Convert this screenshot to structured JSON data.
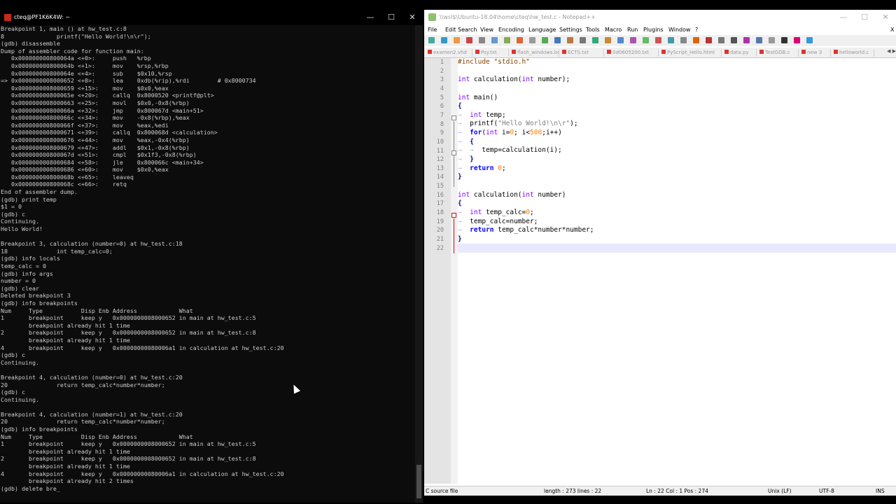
{
  "terminal": {
    "title": "cteq@PF1K6K4W: ~",
    "lines": [
      "Breakpoint 1, main () at hw_test.c:8",
      "8               printf(\"Hello World!\\n\\r\");",
      "(gdb) disassemble",
      "Dump of assembler code for function main:",
      "   0x000000000800064a <+0>:     push   %rbp",
      "   0x000000000800064b <+1>:     mov    %rsp,%rbp",
      "   0x000000000800064e <+4>:     sub    $0x10,%rsp",
      "=> 0x0000000008000652 <+8>:     lea    0xdb(%rip),%rdi        # 0x8000734",
      "   0x0000000008000659 <+15>:    mov    $0x0,%eax",
      "   0x000000000800065e <+20>:    callq  0x8000520 <printf@plt>",
      "   0x0000000008000663 <+25>:    movl   $0x0,-0x8(%rbp)",
      "   0x000000000800066a <+32>:    jmp    0x800067d <main+51>",
      "   0x000000000800066c <+34>:    mov    -0x8(%rbp),%eax",
      "   0x000000000800066f <+37>:    mov    %eax,%edi",
      "   0x0000000008000671 <+39>:    callq  0x800068d <calculation>",
      "   0x0000000008000676 <+44>:    mov    %eax,-0x4(%rbp)",
      "   0x0000000008000679 <+47>:    addl   $0x1,-0x8(%rbp)",
      "   0x000000000800067d <+51>:    cmpl   $0x1f3,-0x8(%rbp)",
      "   0x0000000008000684 <+58>:    jle    0x800066c <main+34>",
      "   0x0000000008000686 <+60>:    mov    $0x0,%eax",
      "   0x000000000800068b <+65>:    leaveq",
      "   0x000000000800068c <+66>:    retq",
      "End of assembler dump.",
      "(gdb) print temp",
      "$1 = 0",
      "(gdb) c",
      "Continuing.",
      "Hello World!",
      "",
      "Breakpoint 3, calculation (number=0) at hw_test.c:18",
      "18              int temp_calc=0;",
      "(gdb) info locals",
      "temp_calc = 0",
      "(gdb) info args",
      "number = 0",
      "(gdb) clear",
      "Deleted breakpoint 3",
      "(gdb) info breakpoints",
      "Num     Type           Disp Enb Address            What",
      "1       breakpoint     keep y   0x0000000008000652 in main at hw_test.c:5",
      "        breakpoint already hit 1 time",
      "2       breakpoint     keep y   0x0000000008000652 in main at hw_test.c:8",
      "        breakpoint already hit 1 time",
      "4       breakpoint     keep y   0x00000000080006a1 in calculation at hw_test.c:20",
      "(gdb) c",
      "Continuing.",
      "",
      "Breakpoint 4, calculation (number=0) at hw_test.c:20",
      "20              return temp_calc*number*number;",
      "(gdb) c",
      "Continuing.",
      "",
      "Breakpoint 4, calculation (number=1) at hw_test.c:20",
      "20              return temp_calc*number*number;",
      "(gdb) info breakpoints",
      "Num     Type           Disp Enb Address            What",
      "1       breakpoint     keep y   0x0000000008000652 in main at hw_test.c:5",
      "        breakpoint already hit 1 time",
      "2       breakpoint     keep y   0x0000000008000652 in main at hw_test.c:8",
      "        breakpoint already hit 1 time",
      "4       breakpoint     keep y   0x00000000080006a1 in calculation at hw_test.c:20",
      "        breakpoint already hit 2 times",
      "(gdb) delete bre_"
    ]
  },
  "notepad": {
    "title": "\\\\wsl$\\Ubuntu-18.04\\home\\cteq\\hw_test.c - Notepad++",
    "menu": [
      "File",
      "Edit",
      "Search",
      "View",
      "Encoding",
      "Language",
      "Settings",
      "Tools",
      "Macro",
      "Run",
      "Plugins",
      "Window",
      "?"
    ],
    "close_x": "X",
    "tabs": [
      "examen2.vhd",
      "Psy.txt",
      "flash_windows.bat",
      "ECTS.txt",
      "0d0605200.txt",
      "PyScript_Hello.html",
      "data.py",
      "TestGDB.c",
      "new 3",
      "helloworld.c"
    ],
    "line_numbers": [
      "1",
      "2",
      "3",
      "4",
      "5",
      "6",
      "7",
      "8",
      "9",
      "10",
      "11",
      "12",
      "13",
      "14",
      "15",
      "16",
      "17",
      "18",
      "19",
      "20",
      "21",
      "22"
    ],
    "code": {
      "l1_pp": "#include \"stdio.h\"",
      "l3_kw": "int",
      "l3_rest": " calculation(",
      "l3_kw2": "int",
      "l3_end": " number);",
      "l5_kw": "int",
      "l5_rest": " main()",
      "brace_open": "{",
      "l7_kw": "int",
      "l7_rest": " temp;",
      "l8_fn": "printf(",
      "l8_str": "\"Hello World!\\n\\r\"",
      "l8_end": ");",
      "l9_kw": "for",
      "l9_a": "(",
      "l9_kw2": "int",
      "l9_b": " i=",
      "l9_n0": "0",
      "l9_c": "; i<",
      "l9_n500": "500",
      "l9_d": ";i++)",
      "l11_text": "temp=calculation(i);",
      "brace_close": "}",
      "l13_kw": "return",
      "l13_num": "0",
      "l13_end": ";",
      "l16_kw": "int",
      "l16_rest": " calculation(",
      "l16_kw2": "int",
      "l16_end": " number)",
      "l18_kw": "int",
      "l18_rest": " temp_calc=",
      "l18_num": "0",
      "l18_end": ";",
      "l19_text": "temp_calc=number;",
      "l20_kw": "return",
      "l20_rest": " temp_calc*number*number;"
    },
    "status": {
      "filetype": "C source file",
      "length": "length : 273    lines : 22",
      "position": "Ln : 22    Col : 1    Pos : 274",
      "eol": "Unix (LF)",
      "encoding": "UTF-8",
      "mode": "INS"
    }
  }
}
